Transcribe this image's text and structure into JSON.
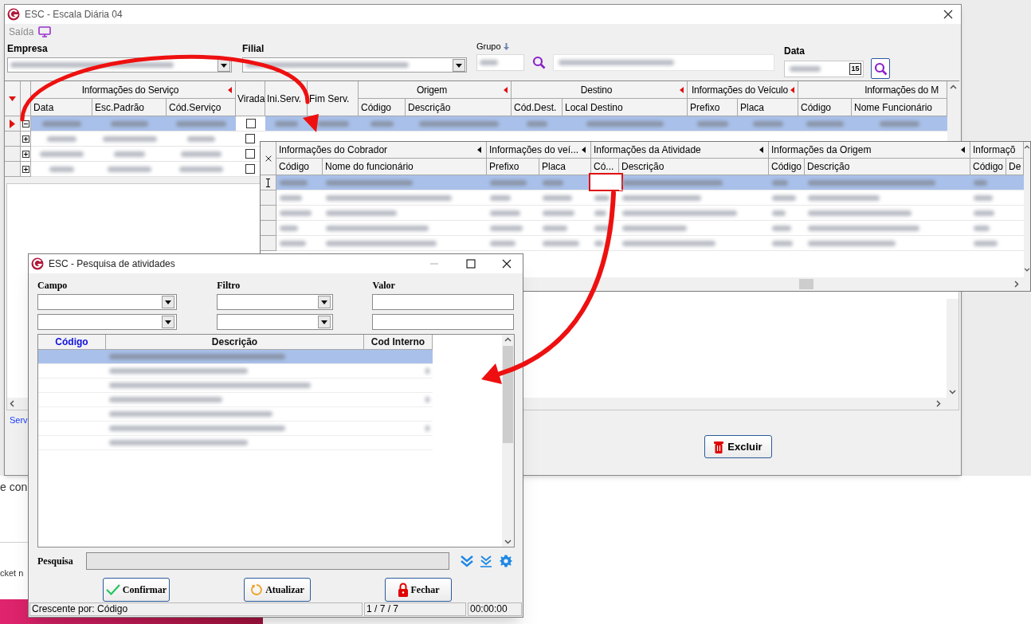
{
  "background": {
    "texts": [
      "e con",
      "cket n"
    ]
  },
  "main_window": {
    "title": "ESC - Escala Diária 04",
    "menu": [
      {
        "label": "Saída"
      }
    ],
    "filters": {
      "empresa_label": "Empresa",
      "filial_label": "Filial",
      "grupo_label": "Grupo",
      "data_label": "Data",
      "calendar_day": "15"
    },
    "grid": {
      "header": [
        {
          "kind": "group",
          "label": "Informações do Serviço",
          "marker": true,
          "columns": [
            {
              "label": "Data"
            },
            {
              "label": "Esc.Padrão"
            },
            {
              "label": "Cód.Serviço"
            }
          ]
        },
        {
          "kind": "checkbox",
          "label": "Virada"
        },
        {
          "kind": "single",
          "label": "Ini.Serv."
        },
        {
          "kind": "single",
          "label": "Fim Serv."
        },
        {
          "kind": "group",
          "label": "Origem",
          "marker": true,
          "columns": [
            {
              "label": "Código"
            },
            {
              "label": "Descrição"
            }
          ]
        },
        {
          "kind": "group",
          "label": "Destino",
          "marker": true,
          "columns": [
            {
              "label": "Cód.Dest."
            },
            {
              "label": "Local Destino"
            }
          ]
        },
        {
          "kind": "group",
          "label": "Informações do Veículo",
          "marker": true,
          "columns": [
            {
              "label": "Prefixo"
            },
            {
              "label": "Placa"
            }
          ]
        },
        {
          "kind": "group",
          "label": "Informações do M",
          "marker": false,
          "columns": [
            {
              "label": "Código"
            },
            {
              "label": "Nome Funcionário"
            }
          ]
        }
      ],
      "rows": [
        {
          "selected": true,
          "expanded": true,
          "virada": false
        },
        {
          "selected": false,
          "expanded": false,
          "virada": false
        },
        {
          "selected": false,
          "expanded": false,
          "virada": false
        },
        {
          "selected": false,
          "expanded": false,
          "virada": false
        }
      ]
    },
    "link": "Serv",
    "buttons": [
      {
        "label": "Excluir",
        "kind": "delete"
      }
    ]
  },
  "detail_grid": {
    "header": [
      {
        "label": "Informações do Cobrador",
        "marker": true,
        "columns": [
          {
            "label": "Código"
          },
          {
            "label": "Nome do funcionário"
          }
        ]
      },
      {
        "label": "Informações do veí...",
        "marker": true,
        "columns": [
          {
            "label": "Prefixo"
          },
          {
            "label": "Placa"
          }
        ]
      },
      {
        "label": "Informações da Atividade",
        "marker": true,
        "columns": [
          {
            "label": "Có..."
          },
          {
            "label": "Descrição"
          }
        ]
      },
      {
        "label": "Informações da Origem",
        "marker": true,
        "columns": [
          {
            "label": "Código"
          },
          {
            "label": "Descrição"
          }
        ]
      },
      {
        "label": "Informaçõ",
        "marker": false,
        "columns": [
          {
            "label": "Código"
          },
          {
            "label": "De"
          }
        ]
      }
    ],
    "rows": [
      {
        "selected": true,
        "highlighted": true
      },
      {
        "selected": false,
        "highlighted": false
      },
      {
        "selected": false,
        "highlighted": false
      },
      {
        "selected": false,
        "highlighted": false
      },
      {
        "selected": false,
        "highlighted": false
      }
    ]
  },
  "dialog": {
    "title": "ESC - Pesquisa de atividades",
    "filter_labels": [
      "Campo",
      "Filtro",
      "Valor"
    ],
    "columns": [
      {
        "label": "Código",
        "sorted": true
      },
      {
        "label": "Descrição",
        "sorted": false
      },
      {
        "label": "Cod Interno",
        "sorted": false
      }
    ],
    "rows": [
      {
        "selected": true
      },
      {
        "selected": false
      },
      {
        "selected": false
      },
      {
        "selected": false
      },
      {
        "selected": false
      },
      {
        "selected": false
      },
      {
        "selected": false
      }
    ],
    "search_label": "Pesquisa",
    "buttons": [
      {
        "label": "Confirmar",
        "kind": "confirm"
      },
      {
        "label": "Atualizar",
        "kind": "refresh"
      },
      {
        "label": "Fechar",
        "kind": "close"
      }
    ],
    "status_bar": [
      "Crescente por: Código",
      "1 / 7 / 7",
      "00:00:00"
    ]
  }
}
